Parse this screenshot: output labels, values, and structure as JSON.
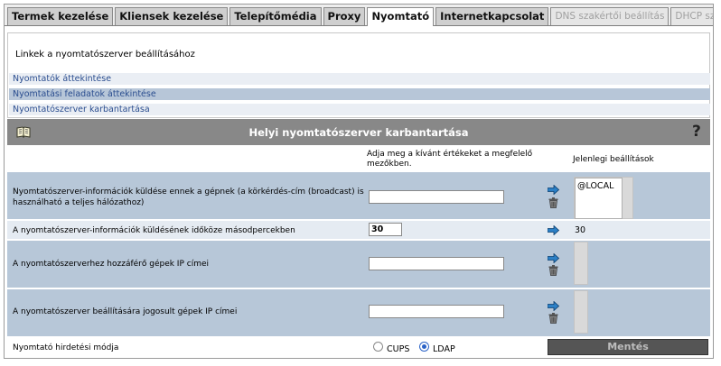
{
  "tabs": [
    {
      "label": "Termek kezelése",
      "state": "normal"
    },
    {
      "label": "Kliensek kezelése",
      "state": "normal"
    },
    {
      "label": "Telepítőmédia",
      "state": "normal"
    },
    {
      "label": "Proxy",
      "state": "normal"
    },
    {
      "label": "Nyomtató",
      "state": "active"
    },
    {
      "label": "Internetkapcsolat",
      "state": "normal"
    },
    {
      "label": "DNS szakértői beállítás",
      "state": "disabled"
    },
    {
      "label": "DHCP szakértői beállítás",
      "state": "disabled"
    }
  ],
  "links": {
    "heading": "Linkek a nyomtatószerver beállításához",
    "items": [
      "Nyomtatók áttekintése",
      "Nyomtatási feladatok áttekintése",
      "Nyomtatószerver karbantartása"
    ]
  },
  "section": {
    "title": "Helyi nyomtatószerver karbantartása",
    "help": "?"
  },
  "columns": {
    "input_header": "Adja meg a kívánt értékeket a megfelelő mezőkben.",
    "current_header": "Jelenlegi beállítások"
  },
  "rows": {
    "broadcast": {
      "label": "Nyomtatószerver-információk küldése ennek a gépnek (a körkérdés-cím (broadcast) is használható a teljes hálózathoz)",
      "value": "",
      "current": "@LOCAL"
    },
    "interval": {
      "label": "A nyomtatószerver-információk küldésének időköze másodpercekben",
      "value": "30",
      "current": "30"
    },
    "access": {
      "label": "A nyomtatószerverhez hozzáférő gépek IP címei",
      "value": ""
    },
    "admin": {
      "label": "A nyomtatószerver beállítására jogosult gépek IP címei",
      "value": ""
    },
    "advert": {
      "label": "Nyomtató hirdetési módja",
      "option_cups": "CUPS",
      "option_ldap": "LDAP",
      "selected": "LDAP"
    }
  },
  "save_label": "Mentés",
  "colors": {
    "row_blue": "#b7c7d8",
    "title_gray": "#888888",
    "link_blue": "#2a4d8f"
  }
}
